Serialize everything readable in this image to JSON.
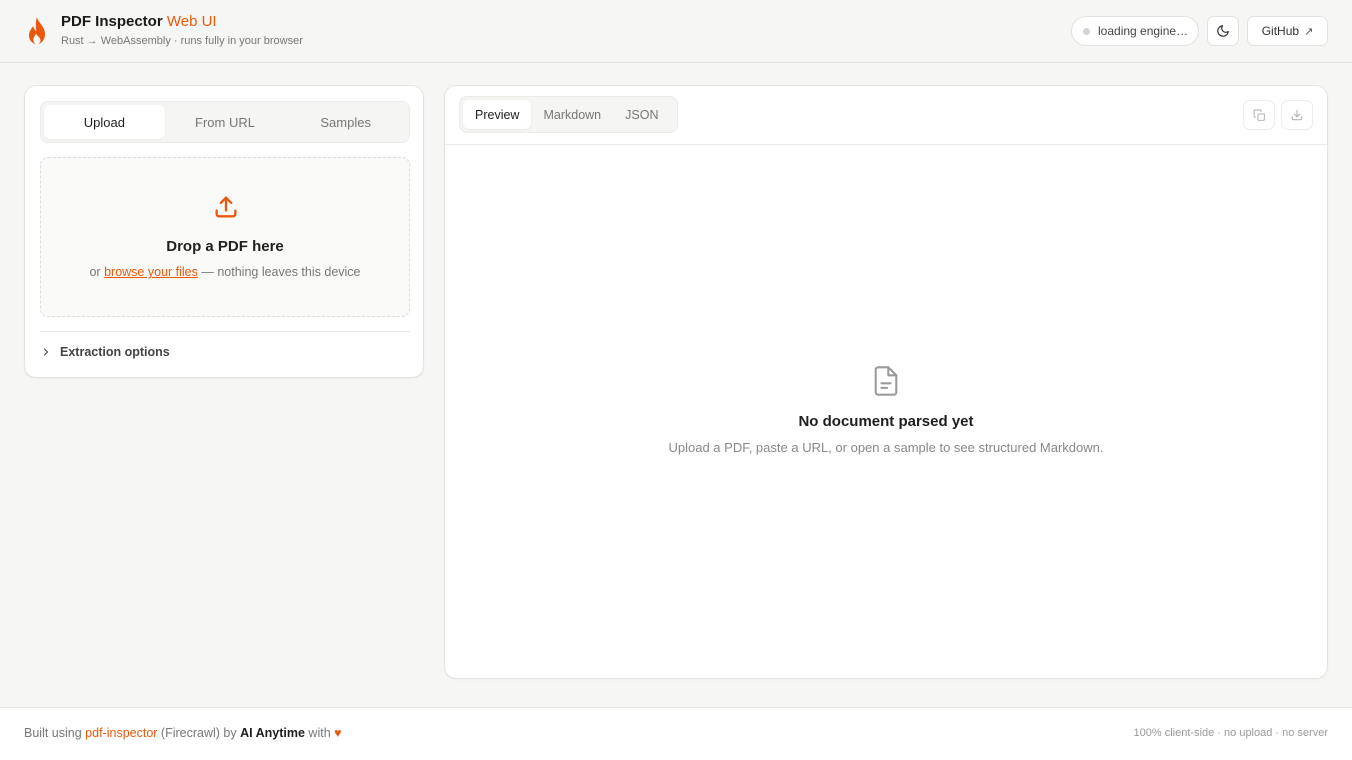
{
  "header": {
    "title": "PDF Inspector",
    "title_accent": "Web UI",
    "subtitle": "Rust → WebAssembly · runs fully in your browser",
    "status": "loading engine…",
    "github_label": "GitHub",
    "github_arrow": "↗"
  },
  "source_tabs": [
    {
      "label": "Upload",
      "active": true
    },
    {
      "label": "From URL",
      "active": false
    },
    {
      "label": "Samples",
      "active": false
    }
  ],
  "dropzone": {
    "title": "Drop a PDF here",
    "prefix": "or",
    "link": "browse your files",
    "suffix": "— nothing leaves this device"
  },
  "extraction_options": {
    "label": "Extraction options"
  },
  "view_tabs": [
    {
      "label": "Preview",
      "active": true
    },
    {
      "label": "Markdown",
      "active": false
    },
    {
      "label": "JSON",
      "active": false
    }
  ],
  "empty_state": {
    "title": "No document parsed yet",
    "subtitle": "Upload a PDF, paste a URL, or open a sample to see structured Markdown."
  },
  "footer": {
    "built_using": "Built using",
    "pkg_link": "pdf-inspector",
    "pkg_note": "(Firecrawl) by",
    "author": "AI Anytime",
    "with": "with",
    "heart": "♥",
    "right_text": "100% client-side · no upload · no server"
  },
  "colors": {
    "accent": "#ea580c",
    "background": "#f6f6f4",
    "panel": "#ffffff",
    "border": "#e4e4e1"
  },
  "icons": [
    "flame-icon",
    "moon-icon",
    "external-link-icon",
    "upload-icon",
    "chevron-right-icon",
    "copy-icon",
    "download-icon",
    "document-icon"
  ]
}
